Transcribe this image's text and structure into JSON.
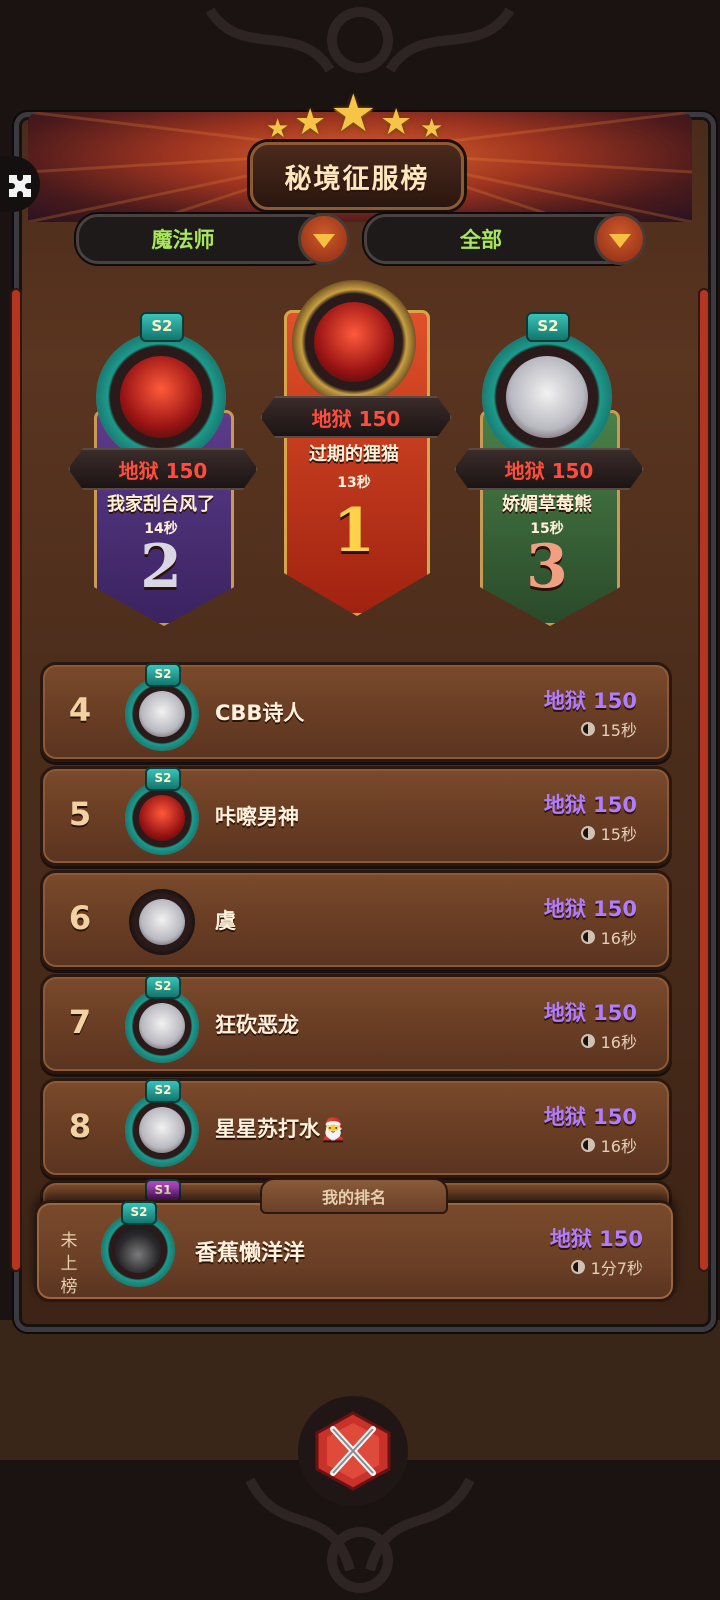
{
  "header": {
    "title": "秘境征服榜"
  },
  "filters": {
    "class": "魔法师",
    "scope": "全部"
  },
  "podium": [
    {
      "rank": "2",
      "difficulty": "地狱 150",
      "name": "我家刮台风了",
      "time": "14秒",
      "season": "S2"
    },
    {
      "rank": "1",
      "difficulty": "地狱 150",
      "name": "过期的狸猫",
      "time": "13秒"
    },
    {
      "rank": "3",
      "difficulty": "地狱 150",
      "name": "娇媚草莓熊",
      "time": "15秒",
      "season": "S2"
    }
  ],
  "list": [
    {
      "rank": "4",
      "name": "CBB诗人",
      "difficulty": "地狱 150",
      "time": "15秒",
      "season": "S2"
    },
    {
      "rank": "5",
      "name": "咔嚓男神",
      "difficulty": "地狱 150",
      "time": "15秒",
      "season": "S2"
    },
    {
      "rank": "6",
      "name": "虞",
      "difficulty": "地狱 150",
      "time": "16秒"
    },
    {
      "rank": "7",
      "name": "狂砍恶龙",
      "difficulty": "地狱 150",
      "time": "16秒",
      "season": "S2"
    },
    {
      "rank": "8",
      "name": "星星苏打水🎅",
      "difficulty": "地狱 150",
      "time": "16秒",
      "season": "S2"
    }
  ],
  "partial_row": {
    "season": "S1"
  },
  "my_rank": {
    "tab_label": "我的排名",
    "status": "未上榜",
    "season": "S2",
    "name": "香蕉懒洋洋",
    "difficulty": "地狱 150",
    "time": "1分7秒"
  },
  "colors": {
    "difficulty_red": "#ff4d3d",
    "difficulty_purple": "#b27cff",
    "filter_green": "#a8e65a"
  },
  "icons": [
    "puzzle-icon",
    "dropdown-arrow-icon",
    "clock-icon",
    "close-crossed-swords-icon"
  ]
}
